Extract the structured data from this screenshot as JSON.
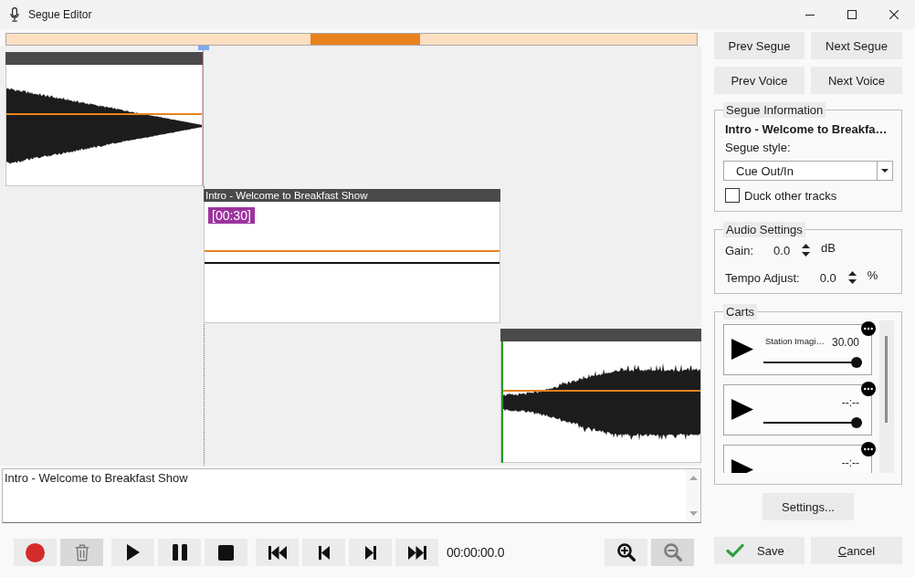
{
  "window": {
    "title": "Segue Editor"
  },
  "timeline": {
    "clips": [
      {
        "kind": "fade_out"
      },
      {
        "kind": "voice",
        "title": "Intro - Welcome to Breakfast Show",
        "badge": "[00:30]"
      },
      {
        "kind": "fade_in"
      }
    ]
  },
  "notes": {
    "value": "Intro - Welcome to Breakfast Show"
  },
  "transport": {
    "groups": [
      {
        "buttons": [
          {
            "kind": "record",
            "disabled": false
          },
          {
            "kind": "delete",
            "disabled": true
          }
        ]
      },
      {
        "buttons": [
          {
            "kind": "play",
            "disabled": false
          },
          {
            "kind": "pause",
            "disabled": false
          },
          {
            "kind": "stop",
            "disabled": false
          }
        ]
      },
      {
        "buttons": [
          {
            "kind": "skip_start",
            "disabled": false
          },
          {
            "kind": "step_back",
            "disabled": false
          },
          {
            "kind": "step_forward",
            "disabled": false
          },
          {
            "kind": "skip_end",
            "disabled": false
          }
        ]
      }
    ],
    "time": "00:00:00.0",
    "zoom_buttons": [
      {
        "kind": "zoom_in",
        "disabled": false
      },
      {
        "kind": "zoom_out",
        "disabled": true
      }
    ]
  },
  "navigation": [
    {
      "label": "Prev Segue"
    },
    {
      "label": "Next Segue"
    },
    {
      "label": "Prev Voice"
    },
    {
      "label": "Next Voice"
    }
  ],
  "segue_information": {
    "legend": "Segue Information",
    "title": "Intro - Welcome to Breakfa…",
    "style_label": "Segue style:",
    "style_value": "Cue Out/In",
    "duck": {
      "label": "Duck other tracks",
      "checked": false
    }
  },
  "audio_settings": {
    "legend": "Audio Settings",
    "rows": [
      {
        "label": "Gain:",
        "value": "0.0",
        "unit": "dB"
      },
      {
        "label": "Tempo Adjust:",
        "value": "0.0",
        "unit": "%"
      }
    ]
  },
  "carts": {
    "legend": "Carts",
    "items": [
      {
        "title": "Station Imagi…",
        "time": "30.00",
        "level": 1
      },
      {
        "time": "--:--",
        "level": 1
      },
      {
        "time": "--:--"
      }
    ]
  },
  "settings_button": {
    "label": "Settings..."
  },
  "save_button": {
    "label": "Save"
  },
  "cancel_button": {
    "label": "Cancel"
  }
}
